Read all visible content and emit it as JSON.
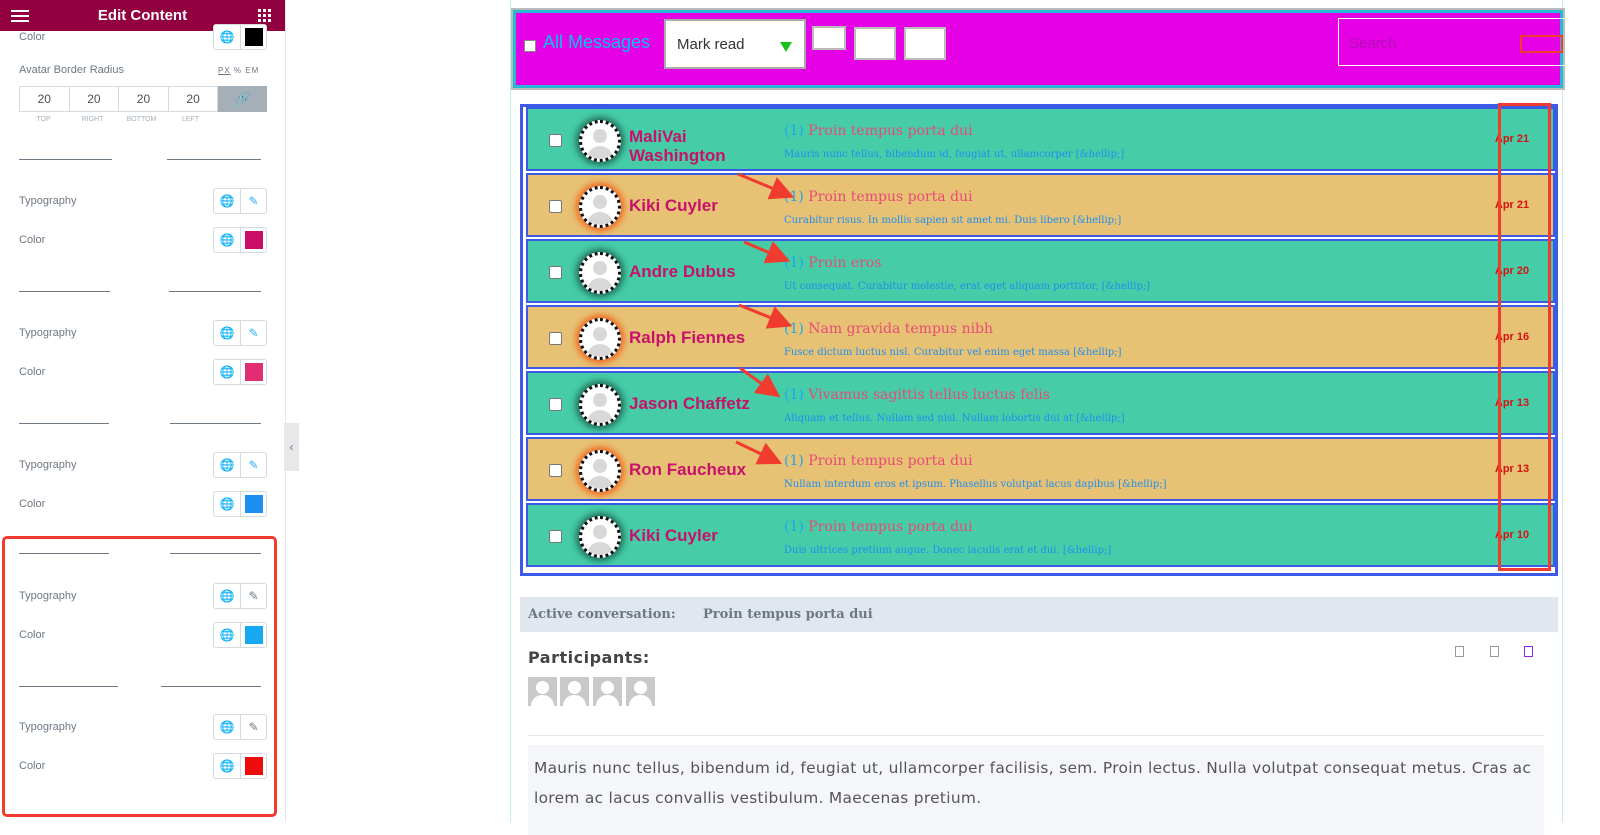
{
  "panel": {
    "title": "Edit Content",
    "color_label_top": "Color",
    "avatar_radius_label": "Avatar Border Radius",
    "units": [
      "PX",
      "%",
      "EM"
    ],
    "dims": [
      "20",
      "20",
      "20",
      "20"
    ],
    "dim_labels": [
      "TOP",
      "RIGHT",
      "BOTTOM",
      "LEFT"
    ],
    "groups": [
      {
        "typography": "Typography",
        "color": "Color",
        "swatch": "#cc0d68"
      },
      {
        "typography": "Typography",
        "color": "Color",
        "swatch": "#e12e73"
      },
      {
        "typography": "Typography",
        "color": "Color",
        "swatch": "#1f8ef1"
      },
      {
        "typography": "Typography",
        "color": "Color",
        "swatch": "#17a8f1"
      },
      {
        "typography": "Typography",
        "color": "Color",
        "swatch": "#ee0b0b"
      }
    ],
    "collapse_glyph": "‹"
  },
  "toolbar": {
    "all_messages": "All Messages",
    "bulk_action": "Mark read",
    "search_placeholder": "Search"
  },
  "messages": [
    {
      "name": "MaliVai Washington",
      "num": "(1)",
      "subject": "Proin tempus porta dui",
      "excerpt": "Mauris nunc tellus, bibendum id, feugiat ut, ullamcorper [&hellip;]",
      "date": "Apr 21",
      "style": "teal"
    },
    {
      "name": "Kiki Cuyler",
      "num": "(1)",
      "subject": "Proin tempus porta dui",
      "excerpt": "Curabitur risus. In mollis sapien sit amet mi. Duis libero [&hellip;]",
      "date": "Apr 21",
      "style": "tan"
    },
    {
      "name": "Andre Dubus",
      "num": "(1)",
      "subject": "Proin eros",
      "excerpt": "Ut consequat. Curabitur molestie, erat eget aliquam porttitor, [&hellip;]",
      "date": "Apr 20",
      "style": "teal"
    },
    {
      "name": "Ralph Fiennes",
      "num": "(1)",
      "subject": "Nam gravida tempus nibh",
      "excerpt": "Fusce dictum luctus nisl. Curabitur vel enim eget massa [&hellip;]",
      "date": "Apr 16",
      "style": "tan"
    },
    {
      "name": "Jason Chaffetz",
      "num": "(1)",
      "subject": "Vivamus sagittis tellus luctus felis",
      "excerpt": "Aliquam et tellus. Nullam sed nisl. Nullam lobortis dui at [&hellip;]",
      "date": "Apr 13",
      "style": "teal"
    },
    {
      "name": "Ron Faucheux",
      "num": "(1)",
      "subject": "Proin tempus porta dui",
      "excerpt": "Nullam interdum eros et ipsum. Phasellus volutpat lacus dapibus [&hellip;]",
      "date": "Apr 13",
      "style": "tan"
    },
    {
      "name": "Kiki Cuyler",
      "num": "(1)",
      "subject": "Proin tempus porta dui",
      "excerpt": "Duis ultrices pretium augue. Donec iaculis erat et dui. [&hellip;]",
      "date": "Apr 10",
      "style": "teal"
    }
  ],
  "conversation": {
    "label": "Active conversation:",
    "title": "Proin tempus porta dui",
    "participants_label": "Participants:",
    "body": "Mauris nunc tellus, bibendum id, feugiat ut, ullamcorper facilisis, sem. Proin lectus. Nulla volutpat consequat metus. Cras ac lorem ac lacus convallis vestibulum. Maecenas pretium."
  }
}
